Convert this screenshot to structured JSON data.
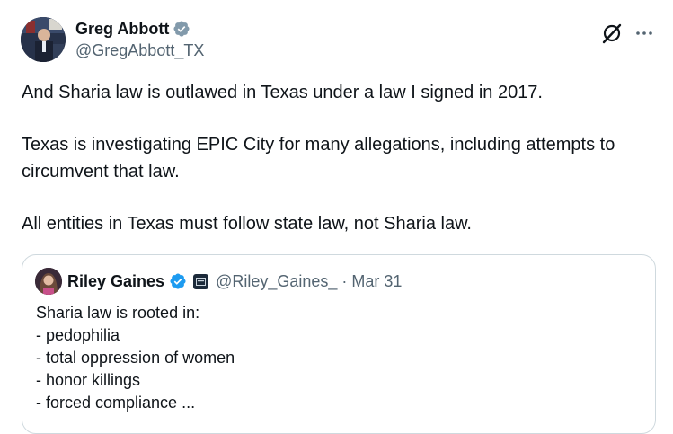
{
  "tweet": {
    "author_name": "Greg Abbott",
    "author_handle": "@GregAbbott_TX",
    "avatar_icon": "profile-photo",
    "verified_icon": "verified-badge-icon",
    "paragraphs": [
      "And Sharia law is outlawed in Texas under a law I signed in 2017.",
      "Texas is investigating EPIC City for many allegations, including attempts to circumvent that law.",
      "All entities in Texas must follow state law, not Sharia law."
    ],
    "actions": {
      "grok_icon": "grok-icon",
      "more_icon": "more-icon"
    }
  },
  "quote": {
    "author_name": "Riley Gaines",
    "author_handle": "@Riley_Gaines_",
    "separator": "·",
    "date": "Mar 31",
    "lines": [
      "Sharia law is rooted in:",
      "- pedophilia",
      "- total oppression of women",
      "- honor killings",
      "- forced compliance ..."
    ]
  },
  "colors": {
    "text": "#0f1419",
    "secondary": "#536471",
    "verified_blue": "#1d9bf0",
    "border": "#cfd9de"
  }
}
